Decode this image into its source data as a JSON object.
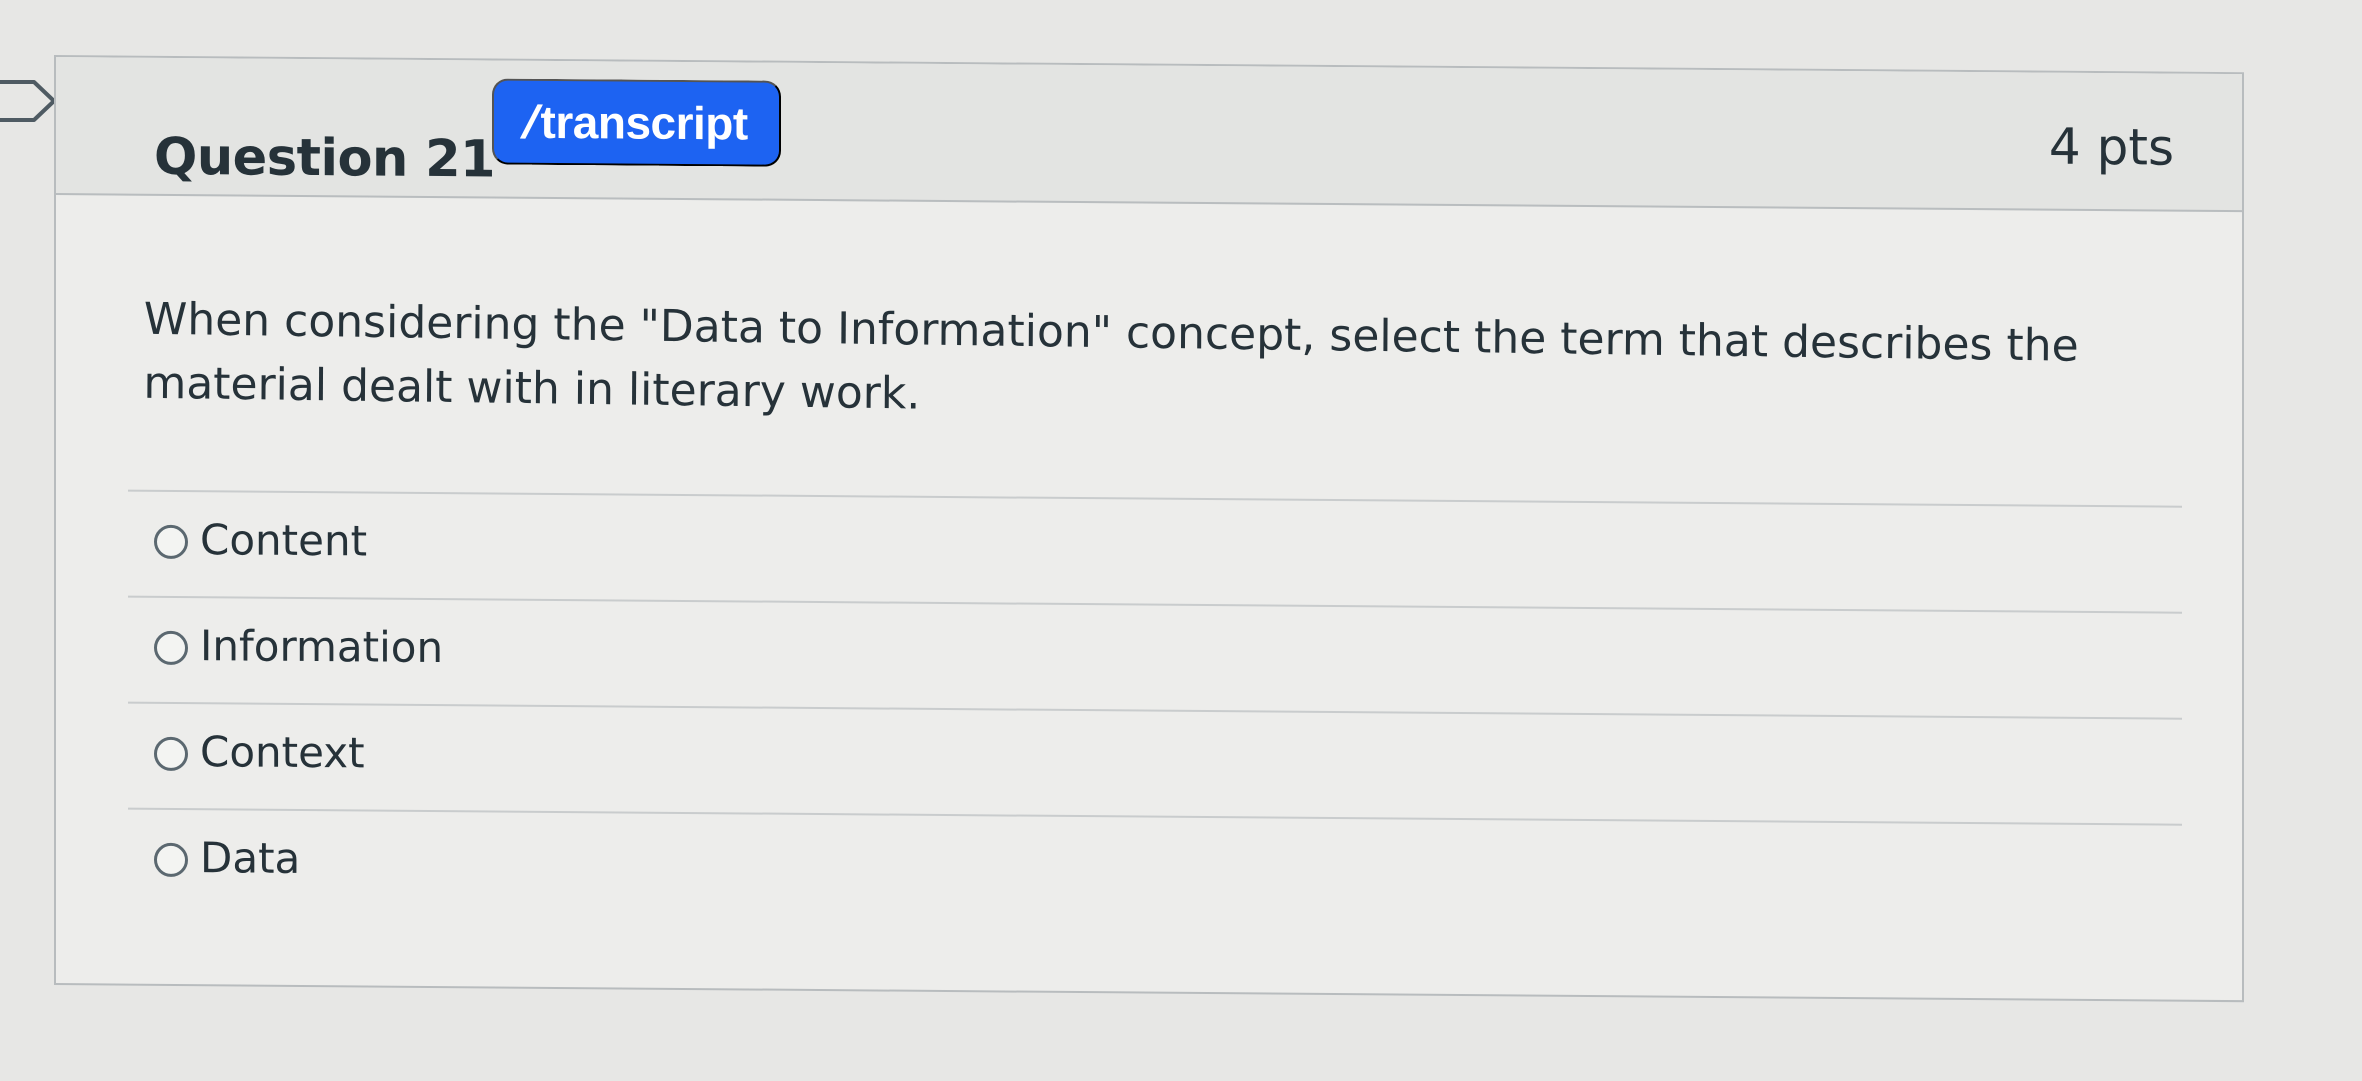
{
  "question": {
    "title": "Question 21",
    "points": "4 pts",
    "badge_label": "transcript",
    "badge_icon": "transcript-slash-icon",
    "text": "When considering the \"Data to Information\" concept, select the term that describes the material dealt with in literary work.",
    "answers": [
      {
        "label": "Content",
        "selected": false
      },
      {
        "label": "Information",
        "selected": false
      },
      {
        "label": "Context",
        "selected": false
      },
      {
        "label": "Data",
        "selected": false
      }
    ]
  },
  "colors": {
    "badge": "#1d63f2",
    "page_background": "#e7e7e5",
    "card_background": "#ededeb",
    "header_background": "#e3e4e2",
    "text": "#263239"
  }
}
